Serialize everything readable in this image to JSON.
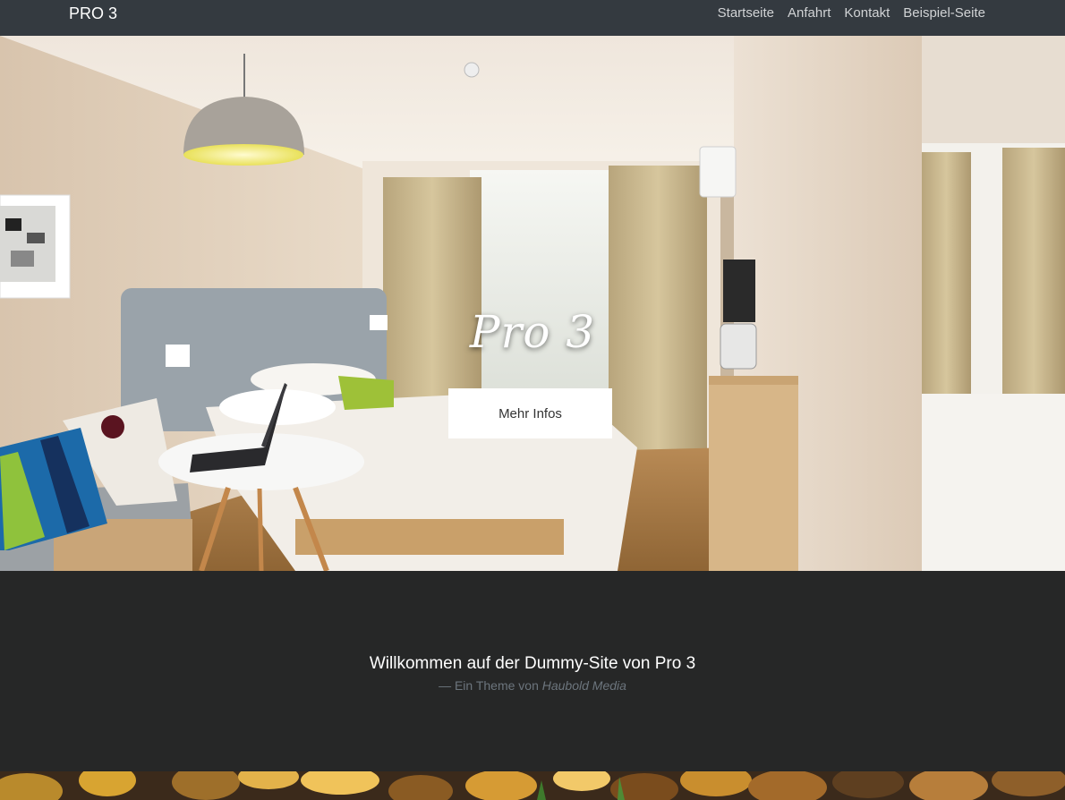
{
  "navbar": {
    "brand": "PRO 3",
    "links": [
      "Startseite",
      "Anfahrt",
      "Kontakt",
      "Beispiel-Seite"
    ]
  },
  "hero": {
    "title": "Pro 3",
    "button_label": "Mehr Infos",
    "image": "hotel-room-photo"
  },
  "welcome": {
    "title": "Willkommen auf der Dummy-Site von Pro 3",
    "sub_prefix": "— Ein Theme von ",
    "sub_author": "Haubold Media"
  },
  "footer_strip": {
    "image": "stacked-logs-photo"
  },
  "colors": {
    "navbar": "#343a40",
    "section_bg": "#262727",
    "muted_text": "#6c757d"
  }
}
